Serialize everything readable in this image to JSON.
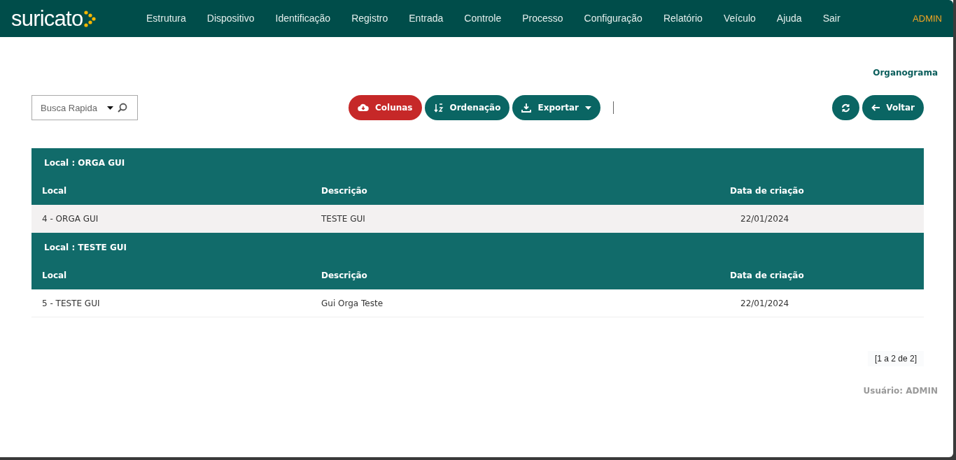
{
  "nav": {
    "logo": "suricato",
    "items": [
      "Estrutura",
      "Dispositivo",
      "Identificação",
      "Registro",
      "Entrada",
      "Controle",
      "Processo",
      "Configuração",
      "Relatório",
      "Veículo",
      "Ajuda",
      "Sair"
    ],
    "user": "ADMIN"
  },
  "page_link": "Organograma",
  "toolbar": {
    "search": {
      "placeholder": "Busca Rapida"
    },
    "buttons": [
      {
        "label": "Colunas",
        "kind": "columns"
      },
      {
        "label": "Ordenação",
        "kind": "sort"
      },
      {
        "label": "Exportar",
        "kind": "export"
      }
    ],
    "back": {
      "label": "Voltar"
    }
  },
  "groups": [
    {
      "title": "Local : ORGA GUI",
      "columns": [
        "Local",
        "Descrição",
        "Data de criação"
      ],
      "rows": [
        {
          "cells": [
            "4 - ORGA GUI",
            "TESTE GUI",
            "22/01/2024"
          ],
          "highlighted": true
        }
      ]
    },
    {
      "title": "Local : TESTE GUI",
      "columns": [
        "Local",
        "Descrição",
        "Data de criação"
      ],
      "rows": [
        {
          "cells": [
            "5 - TESTE GUI",
            "Gui Orga Teste",
            "22/01/2024"
          ],
          "highlighted": false
        }
      ]
    }
  ],
  "pagination": "[1 a 2 de 2]",
  "footer_user": "Usuário: ADMIN"
}
